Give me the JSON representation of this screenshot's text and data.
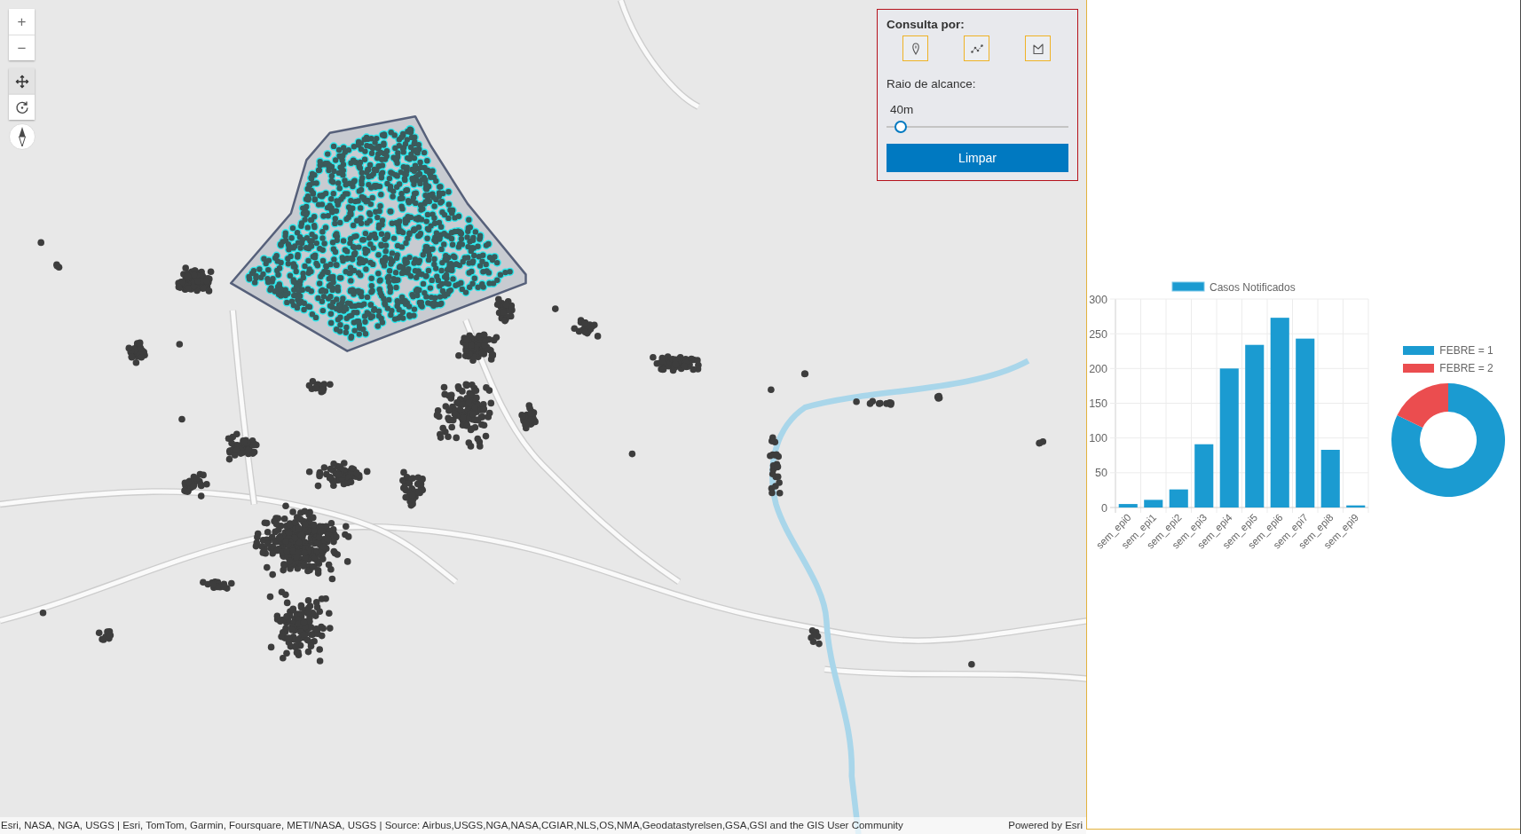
{
  "map_controls": {
    "zoom_in": "+",
    "zoom_out": "−",
    "navigation": [
      {
        "kind": "pan",
        "selected": true
      },
      {
        "kind": "rotate",
        "selected": false
      }
    ]
  },
  "query_panel": {
    "title": "Consulta por:",
    "tools": [
      {
        "kind": "point"
      },
      {
        "kind": "polyline"
      },
      {
        "kind": "polygon"
      }
    ],
    "radius_label": "Raio de alcance:",
    "radius_slider": {
      "reading": "40m",
      "level": 0.08
    },
    "clear_button": "Limpar"
  },
  "attribution": {
    "sources": "Esri, NASA, NGA, USGS | Esri, TomTom, Garmin, Foursquare, METI/NASA, USGS | Source: Airbus,USGS,NGA,NASA,CGIAR,NLS,OS,NMA,Geodatastyrelsen,GSA,GSI and the GIS User Community",
    "powered_by": "Powered by Esri"
  },
  "bar_chart": {
    "chart_data": {
      "type": "bar",
      "categories": [
        "sem_epi0",
        "sem_epi1",
        "sem_epi2",
        "sem_epi3",
        "sem_epi4",
        "sem_epi5",
        "sem_epi6",
        "sem_epi7",
        "sem_epi8",
        "sem_epi9"
      ],
      "series": [
        {
          "name": "Casos Notificados",
          "color": "#1b9bd1",
          "values": [
            5,
            11,
            26,
            91,
            200,
            234,
            273,
            243,
            83,
            3
          ]
        }
      ],
      "ylim": [
        0,
        300
      ],
      "yticks": [
        0,
        50,
        100,
        150,
        200,
        250,
        300
      ],
      "grid": true
    }
  },
  "donut_chart": {
    "legend": [
      {
        "label": "FEBRE = 1",
        "color": "#1b9bd1"
      },
      {
        "label": "FEBRE = 2",
        "color": "#eb4d4f"
      }
    ]
  }
}
